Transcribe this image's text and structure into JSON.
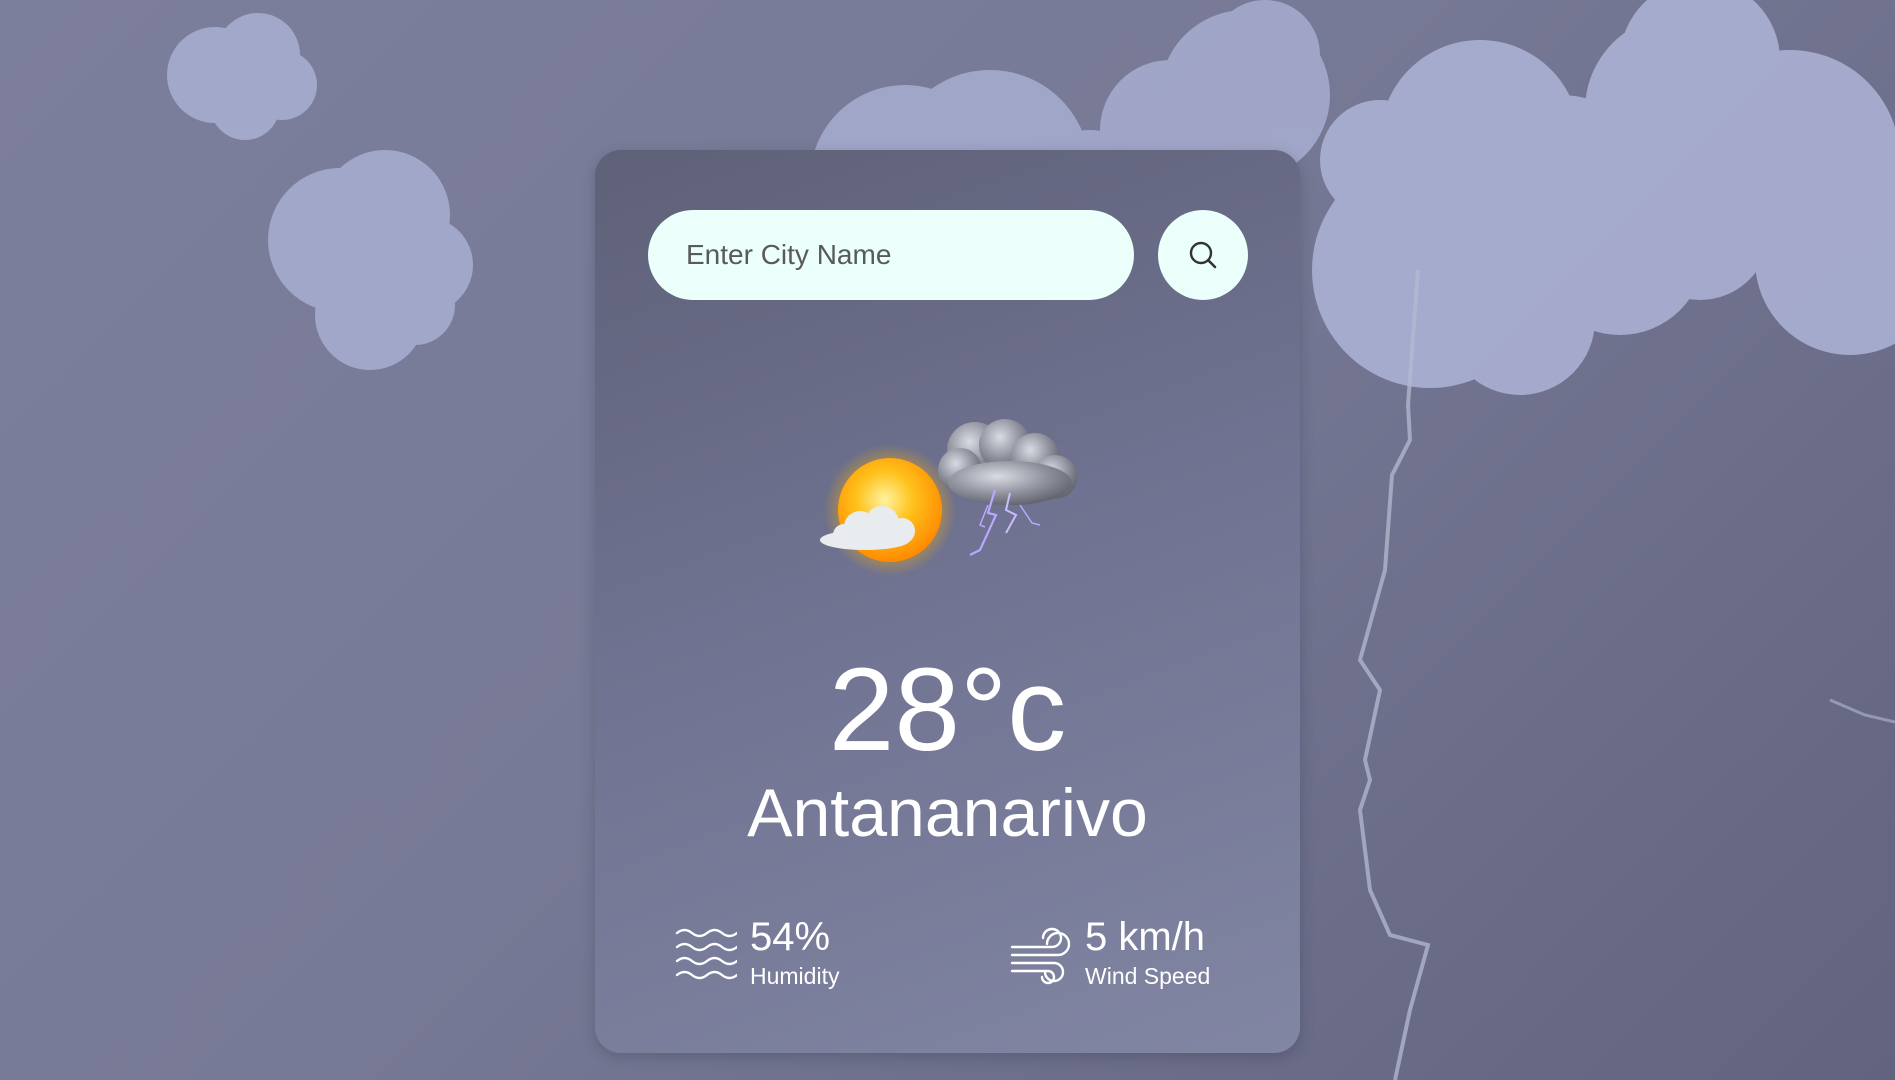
{
  "search": {
    "placeholder": "Enter City Name",
    "icon": "search-icon"
  },
  "weather": {
    "icon": "thunderstorm-icon",
    "temperature": "28°c",
    "city": "Antananarivo"
  },
  "details": {
    "humidity": {
      "icon": "humidity-icon",
      "value": "54%",
      "label": "Humidity"
    },
    "wind": {
      "icon": "wind-icon",
      "value": "5 km/h",
      "label": "Wind Speed"
    }
  },
  "colors": {
    "background": "#777a96",
    "card": "#6f7290",
    "input_background": "#ebfffb",
    "cloud": "#a8aed0",
    "text": "#ffffff"
  }
}
